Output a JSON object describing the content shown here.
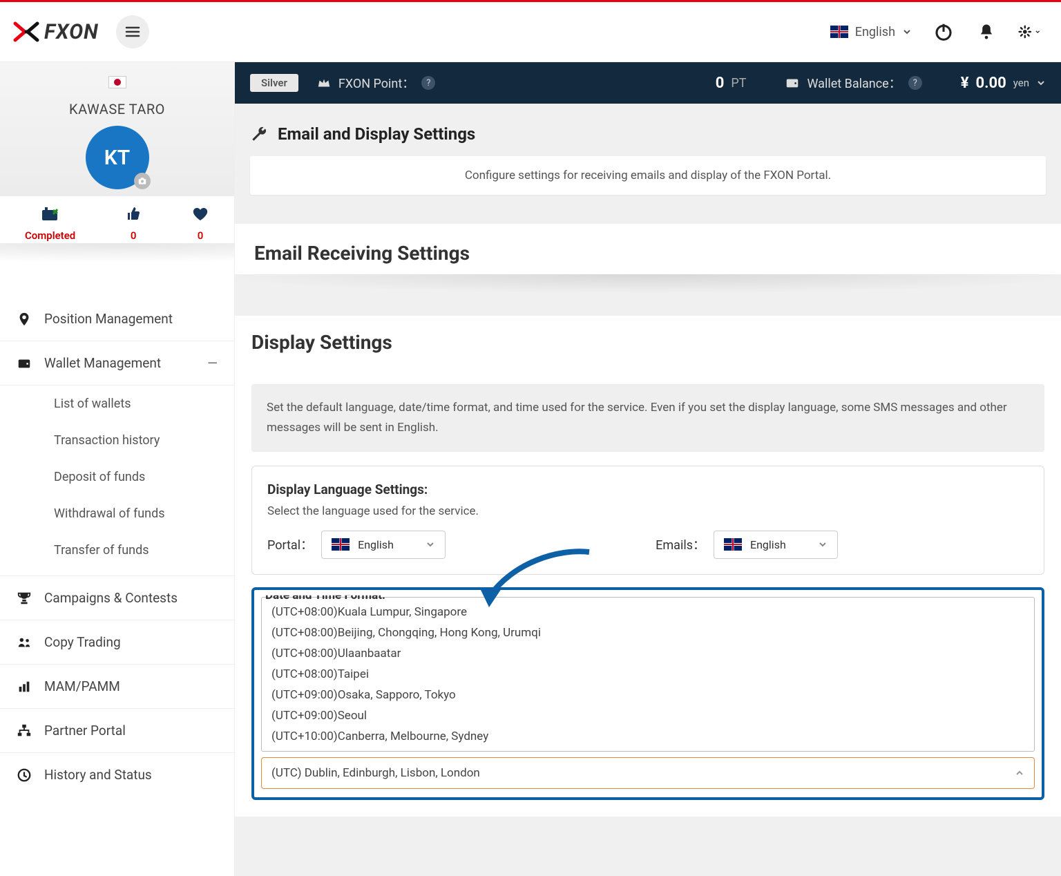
{
  "header": {
    "brand": "FXON",
    "language_label": "English"
  },
  "statusbar": {
    "tier": "Silver",
    "points_label": "FXON Point：",
    "points_value": "0",
    "points_unit": "PT",
    "balance_label": "Wallet Balance：",
    "balance_symbol": "¥",
    "balance_value": "0.00",
    "balance_unit": "yen"
  },
  "profile": {
    "name": "KAWASE TARO",
    "initials": "KT",
    "stat_completed": "Completed",
    "stat_likes": "0",
    "stat_fav": "0"
  },
  "sidebar": {
    "position": "Position Management",
    "wallet": "Wallet Management",
    "wallet_sub": {
      "list": "List of wallets",
      "history": "Transaction history",
      "deposit": "Deposit of funds",
      "withdraw": "Withdrawal of funds",
      "transfer": "Transfer of funds"
    },
    "campaigns": "Campaigns & Contests",
    "copy": "Copy Trading",
    "mam": "MAM/PAMM",
    "partner": "Partner Portal",
    "history": "History and Status"
  },
  "page": {
    "title": "Email and Display Settings",
    "subtitle_card": "Configure settings for receiving emails and display of the FXON Portal.",
    "email_section": "Email Receiving Settings",
    "display_section": "Display Settings",
    "display_info": "Set the default language, date/time format, and time used for the service. Even if you set the display language, some SMS messages and other messages will be sent in English.",
    "lang_panel_title": "Display Language Settings:",
    "lang_panel_hint": "Select the language used for the service.",
    "portal_label": "Portal：",
    "portal_value": "English",
    "emails_label": "Emails：",
    "emails_value": "English",
    "datetime_panel_title": "Date and Time Format:",
    "timezones": [
      "(UTC+08:00)Kuala Lumpur, Singapore",
      "(UTC+08:00)Beijing, Chongqing, Hong Kong, Urumqi",
      "(UTC+08:00)Ulaanbaatar",
      "(UTC+08:00)Taipei",
      "(UTC+09:00)Osaka, Sapporo, Tokyo",
      "(UTC+09:00)Seoul",
      "(UTC+10:00)Canberra, Melbourne, Sydney"
    ],
    "timezone_selected": "(UTC) Dublin, Edinburgh, Lisbon, London"
  }
}
